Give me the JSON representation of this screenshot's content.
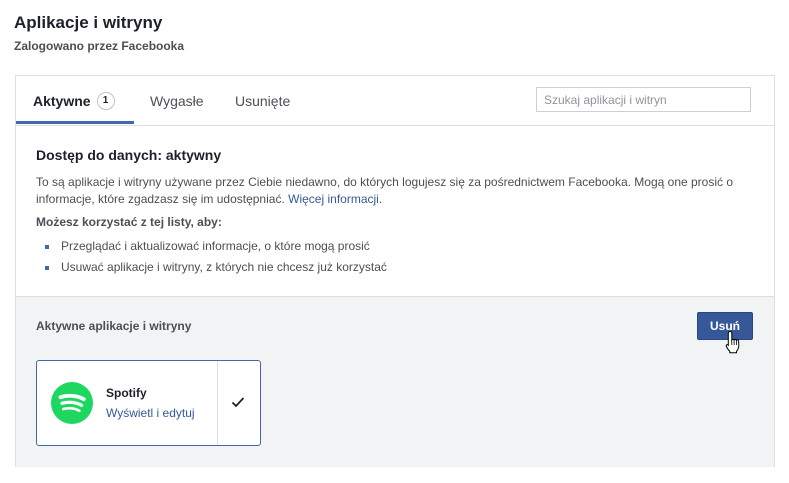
{
  "header": {
    "title": "Aplikacje i witryny",
    "subtitle": "Zalogowano przez Facebooka"
  },
  "tabs": [
    {
      "label": "Aktywne",
      "count": "1",
      "active": true
    },
    {
      "label": "Wygasłe",
      "active": false
    },
    {
      "label": "Usunięte",
      "active": false
    }
  ],
  "search": {
    "placeholder": "Szukaj aplikacji i witryn",
    "value": ""
  },
  "info": {
    "title": "Dostęp do danych: aktywny",
    "text": "To są aplikacje i witryny używane przez Ciebie niedawno, do których logujesz się za pośrednictwem Facebooka. Mogą one prosić o informacje, które zgadzasz się im udostępniać.",
    "more_link": "Więcej informacji",
    "list_heading": "Możesz korzystać z tej listy, aby:",
    "bullets": [
      "Przeglądać i aktualizować informacje, o które mogą prosić",
      "Usuwać aplikacje i witryny, z których nie chcesz już korzystać"
    ]
  },
  "active_section": {
    "label": "Aktywne aplikacje i witryny",
    "remove_button": "Usuń"
  },
  "apps": [
    {
      "name": "Spotify",
      "link": "Wyświetl i edytuj",
      "checked": true,
      "icon": "spotify-logo",
      "brand_color": "#1ed760"
    }
  ],
  "colors": {
    "accent": "#4267b2",
    "button": "#365899",
    "link": "#365899"
  }
}
